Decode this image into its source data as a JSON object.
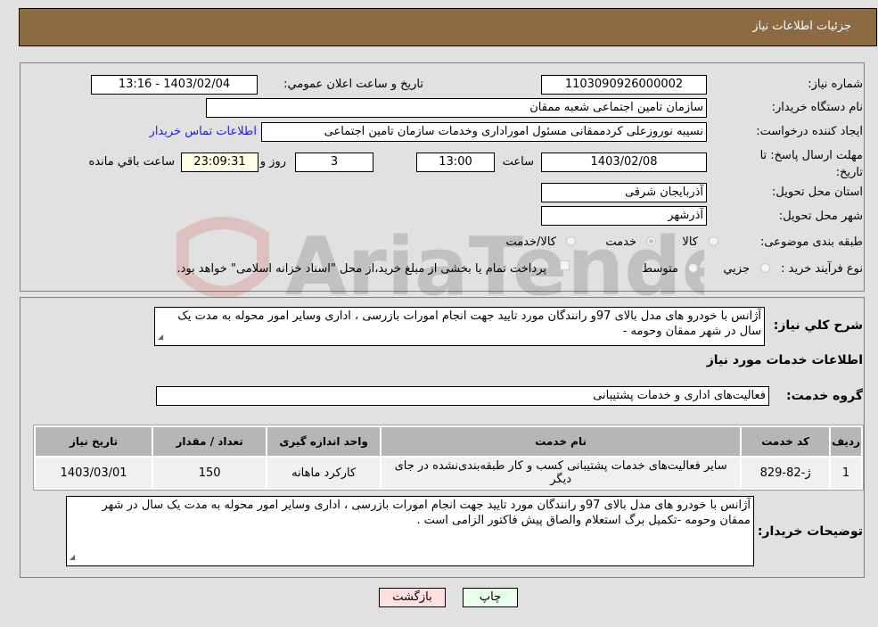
{
  "header": {
    "title": "جزئیات اطلاعات نیاز"
  },
  "form": {
    "need_number": {
      "label": "شماره نیاز:",
      "value": "1103090926000002"
    },
    "announce_datetime": {
      "label": "تاریخ و ساعت اعلان عمومي:",
      "value": "1403/02/04 - 13:16"
    },
    "buyer_org": {
      "label": "نام دستگاه خریدار:",
      "value": "سازمان تامین اجتماعی شعبه ممقان"
    },
    "requester": {
      "label": "ایجاد کننده درخواست:",
      "value": "نسیبه  نوروزعلی کردممقانی مسئول اموراداری وخدمات  سازمان تامین اجتماعی",
      "contact_link": "اطلاعات تماس خریدار"
    },
    "deadline": {
      "label": "مهلت ارسال پاسخ: تا تاریخ:",
      "date": "1403/02/08",
      "time_label": "ساعت",
      "time": "13:00",
      "days": "3",
      "days_label": "روز و",
      "remaining": "23:09:31",
      "remaining_label": "ساعت باقي مانده"
    },
    "province": {
      "label": "استان محل تحویل:",
      "value": "آذربایجان شرقی"
    },
    "city": {
      "label": "شهر محل تحویل:",
      "value": "آذرشهر"
    },
    "category": {
      "label": "طبقه بندی موضوعی:",
      "options": [
        "کالا",
        "خدمت",
        "کالا/خدمت"
      ],
      "selected": "خدمت"
    },
    "purchase_type": {
      "label": "نوع فرآیند خرید :",
      "options": [
        "جزيي",
        "متوسط"
      ],
      "selected": "جزيي",
      "treasury_note": "پرداخت تمام یا بخشی از مبلغ خرید،از محل \"اسناد خزانه اسلامی\" خواهد بود."
    }
  },
  "description": {
    "label": "شرح كلي نیاز:",
    "value": "آژانس با خودرو های مدل بالای 97و رانندگان مورد تایید جهت انجام امورات بازرسی ، اداری وسایر امور محوله به مدت یک سال در شهر ممقان وحومه -"
  },
  "services_section": {
    "title": "اطلاعات خدمات مورد نیاز"
  },
  "service_group": {
    "label": "گروه خدمت:",
    "value": "فعالیت‌های اداری و خدمات پشتیبانی"
  },
  "table": {
    "headers": [
      "ردیف",
      "کد خدمت",
      "نام خدمت",
      "واحد اندازه گیری",
      "تعداد / مقدار",
      "تاریخ نیاز"
    ],
    "rows": [
      [
        "1",
        "ژ-82-829",
        "سایر فعالیت‌های خدمات پشتیبانی کسب و کار طبقه‌بندی‌نشده در جای دیگر",
        "کارکرد ماهانه",
        "150",
        "1403/03/01"
      ]
    ]
  },
  "buyer_notes": {
    "label": "توضیحات خریدار:",
    "value": "آژانس با خودرو های مدل بالای 97و رانندگان مورد تایید جهت انجام امورات بازرسی ، اداری وسایر امور محوله به مدت یک سال در شهر ممقان وحومه -تکمیل برگ استعلام والصاق پیش فاکتور الزامی است ."
  },
  "buttons": {
    "print": "چاپ",
    "back": "بازگشت"
  },
  "colors": {
    "header_bg": "#8c6b42",
    "print_bg": "#eaffea",
    "back_bg": "#ffe0e0",
    "link": "#2020e0",
    "remaining_bg": "#ffffe8"
  },
  "watermark": {
    "text": "AriaTender.neT"
  }
}
